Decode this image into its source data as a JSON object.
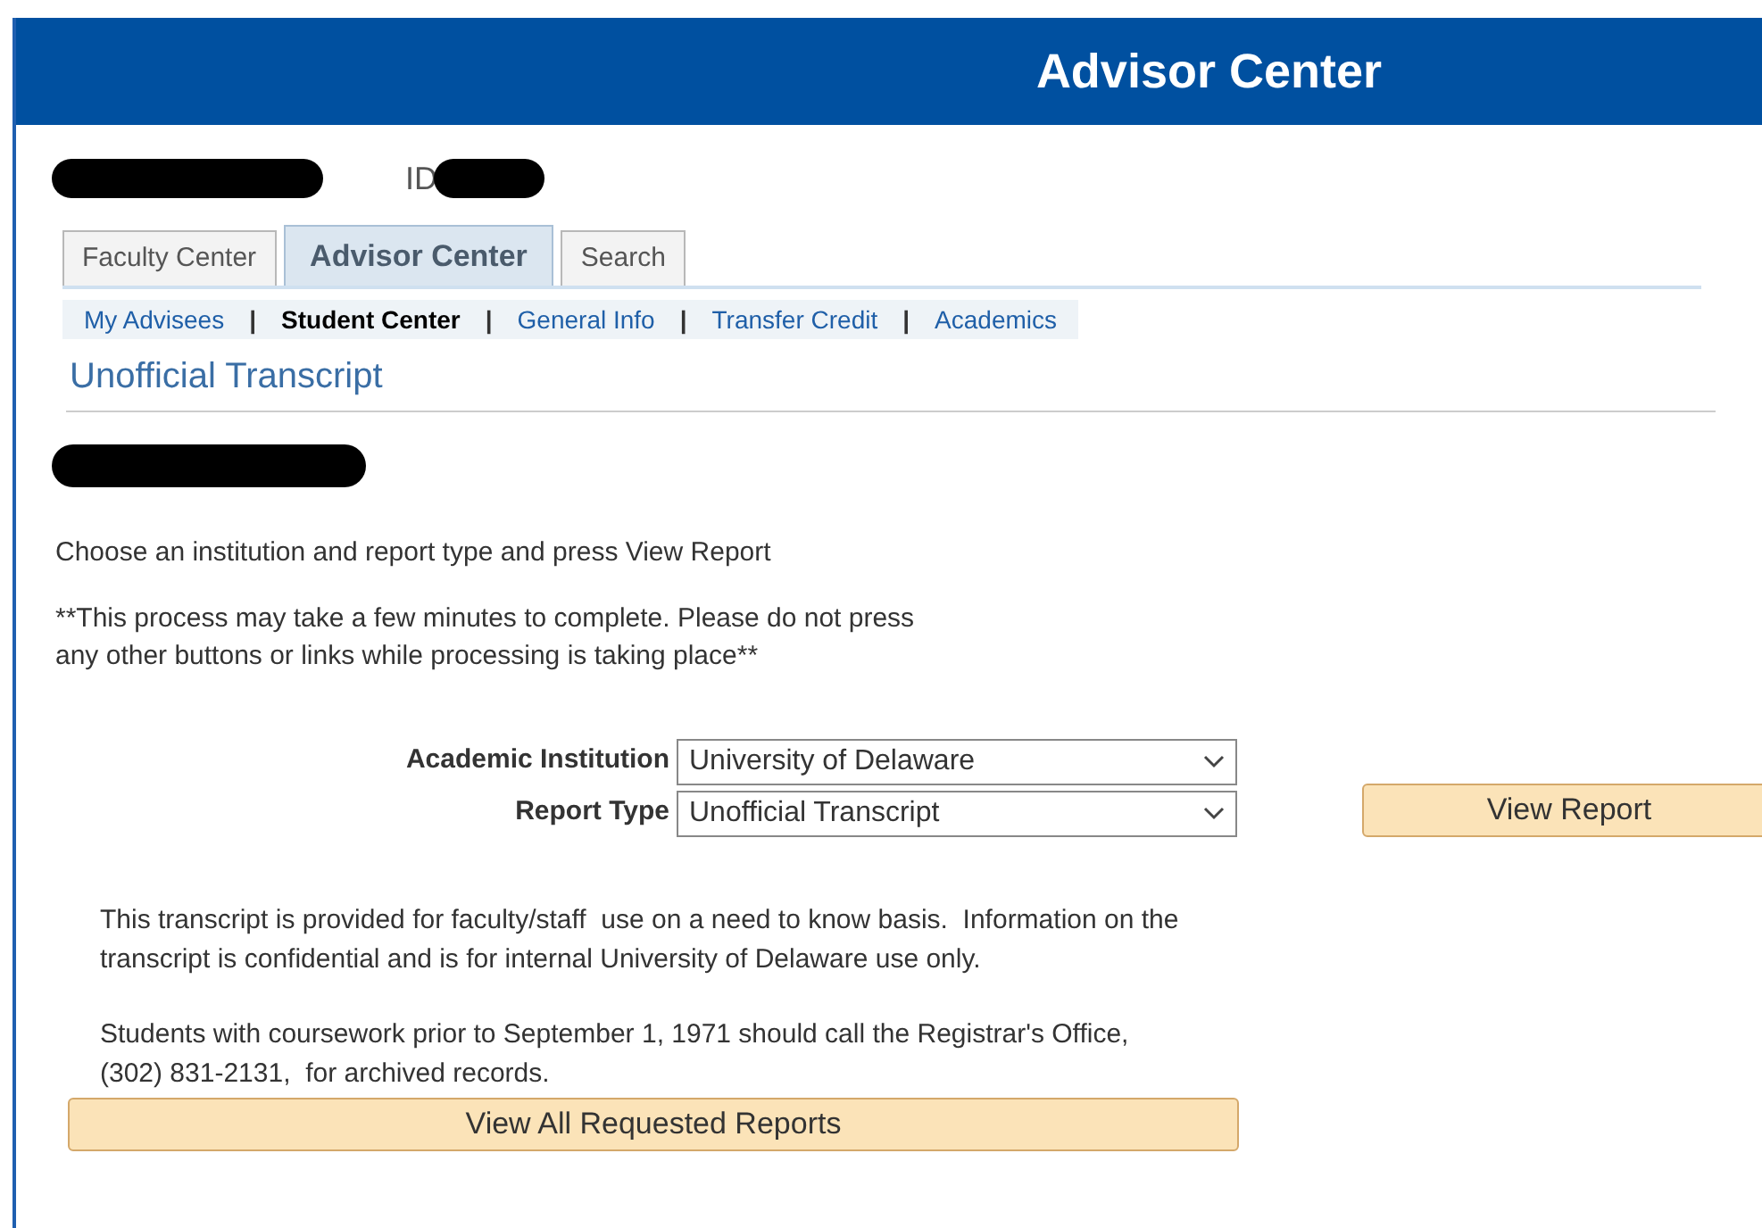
{
  "header": {
    "title": "Advisor Center"
  },
  "person": {
    "id_label": "ID"
  },
  "tabs": [
    {
      "label": "Faculty Center",
      "selected": false
    },
    {
      "label": "Advisor Center",
      "selected": true
    },
    {
      "label": "Search",
      "selected": false
    }
  ],
  "subnav": {
    "separator": "|",
    "items": [
      {
        "label": "My Advisees",
        "selected": false
      },
      {
        "label": "Student Center",
        "selected": true
      },
      {
        "label": "General Info",
        "selected": false
      },
      {
        "label": "Transfer Credit",
        "selected": false
      },
      {
        "label": "Academics",
        "selected": false
      }
    ]
  },
  "page_title": "Unofficial Transcript",
  "instructions": "Choose an institution and report type and press View Report",
  "warning": [
    "**This process may take a few minutes to complete. Please do not press",
    "any other buttons or links while processing is taking place**"
  ],
  "form": {
    "fields": [
      {
        "label": "Academic Institution",
        "value": "University of Delaware"
      },
      {
        "label": "Report Type",
        "value": "Unofficial Transcript"
      }
    ],
    "button": "View Report"
  },
  "notice": [
    "This transcript is provided for faculty/staff  use on a need to know basis.  Information on the",
    "transcript is confidential and is for internal University of Delaware use only."
  ],
  "archive_note": [
    "Students with coursework prior to September 1, 1971 should call the Registrar's Office,",
    "(302) 831-2131,  for archived records."
  ],
  "bottom_button": "View All Requested Reports"
}
